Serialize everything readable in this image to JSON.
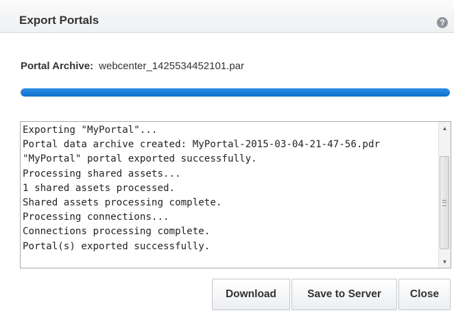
{
  "dialog": {
    "title": "Export Portals",
    "help_icon": "help-circle-icon"
  },
  "archive": {
    "label": "Portal Archive:",
    "filename": "webcenter_1425534452101.par"
  },
  "progress": {
    "percent": 100,
    "color": "#1a7bd8"
  },
  "log": {
    "lines": [
      "Exporting \"MyPortal\"...",
      "Portal data archive created: MyPortal-2015-03-04-21-47-56.pdr",
      "\"MyPortal\" portal exported successfully.",
      "Processing shared assets...",
      "1 shared assets processed.",
      "Shared assets processing complete.",
      "Processing connections...",
      "Connections processing complete.",
      "Portal(s) exported successfully."
    ]
  },
  "buttons": {
    "download": "Download",
    "save_to_server": "Save to Server",
    "close": "Close"
  }
}
